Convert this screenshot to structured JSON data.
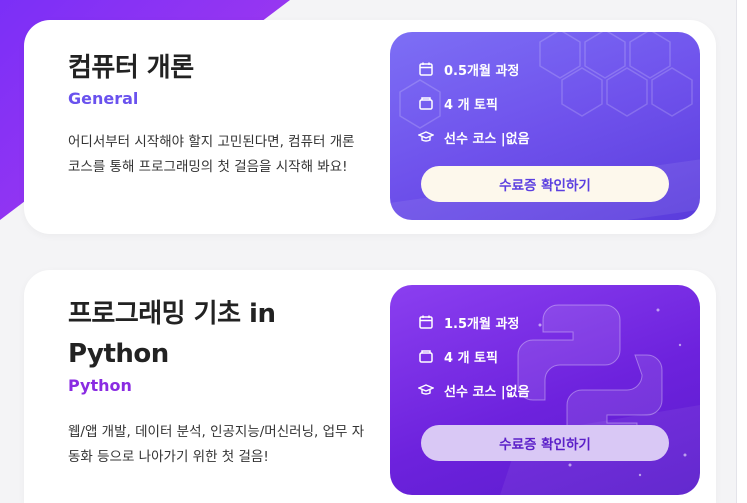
{
  "courses": [
    {
      "title": "컴퓨터 개론",
      "subtitle": "General",
      "description": "어디서부터 시작해야 할지 고민된다면, 컴퓨터 개론 코스를 통해 프로그래밍의 첫 걸음을 시작해 봐요!",
      "info": [
        {
          "icon": "calendar-icon",
          "text": "0.5개월 과정"
        },
        {
          "icon": "folder-icon",
          "text": "4 개 토픽"
        },
        {
          "icon": "graduation-cap-icon",
          "text": "선수 코스 |없음"
        }
      ],
      "button_label": "수료증 확인하기"
    },
    {
      "title": "프로그래밍 기초 in Python",
      "subtitle": "Python",
      "description": "웹/앱 개발, 데이터 분석, 인공지능/머신러닝, 업무 자동화 등으로 나아가기 위한 첫 걸음!",
      "info": [
        {
          "icon": "calendar-icon",
          "text": "1.5개월 과정"
        },
        {
          "icon": "folder-icon",
          "text": "4 개 토픽"
        },
        {
          "icon": "graduation-cap-icon",
          "text": "선수 코스 |없음"
        }
      ],
      "button_label": "수료증 확인하기"
    }
  ],
  "colors": {
    "accent_general": "#6a52ee",
    "accent_python": "#8a2be2",
    "panel_general": "#6f52ec",
    "panel_python": "#6d22dd"
  }
}
